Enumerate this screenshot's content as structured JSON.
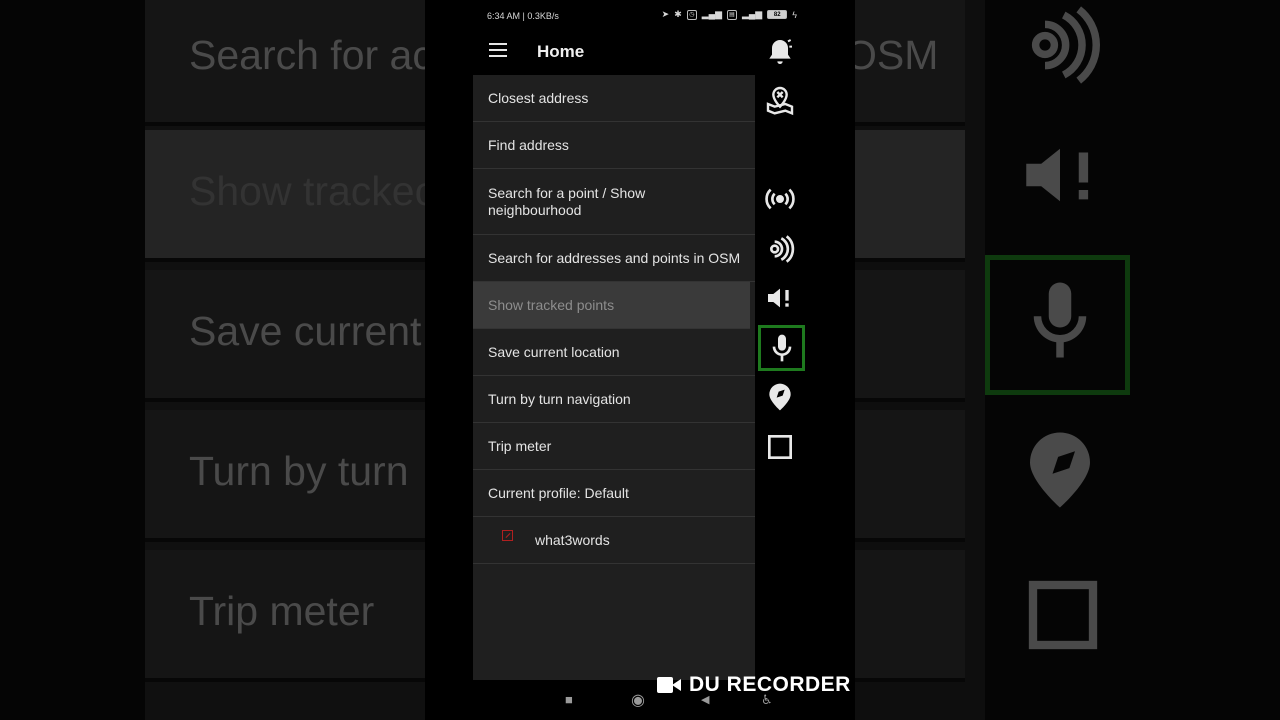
{
  "status_bar": {
    "time_speed": "6:34 AM | 0.3KB/s",
    "battery": "82"
  },
  "app_bar": {
    "title": "Home",
    "menu_icon": "hamburger-menu-icon"
  },
  "menu": {
    "items": [
      {
        "label": "Closest address"
      },
      {
        "label": "Find address"
      },
      {
        "label": "Search for a point / Show neighbourhood"
      },
      {
        "label": "Search for addresses and points in OSM"
      },
      {
        "label": "Show tracked points",
        "selected": true
      },
      {
        "label": "Save current location"
      },
      {
        "label": "Turn by turn navigation"
      },
      {
        "label": "Trip meter"
      },
      {
        "label": "Current profile: Default"
      }
    ],
    "plugin": {
      "label": "what3words",
      "icon": "what3words-icon"
    }
  },
  "side_buttons": [
    {
      "name": "notification-bell-icon"
    },
    {
      "name": "map-marker-cancel-icon"
    },
    {
      "name": "broadcast-icon"
    },
    {
      "name": "radar-icon"
    },
    {
      "name": "speaker-alert-icon"
    },
    {
      "name": "microphone-icon",
      "active": true
    },
    {
      "name": "compass-marker-icon"
    },
    {
      "name": "square-stop-icon"
    }
  ],
  "background_text": {
    "rows": [
      "Search for ac",
      "Show trackec",
      "Save current",
      "Turn by turn",
      "Trip meter"
    ],
    "right_fragment": "OSM"
  },
  "nav_bar": {
    "recent": "■",
    "home": "◉",
    "back": "◀",
    "accessibility": "♿"
  },
  "watermark": {
    "text": "DU RECORDER"
  },
  "colors": {
    "active_outline": "#1e7a1e",
    "list_bg": "#1f1f1f",
    "selected_bg": "#3a3a3a"
  }
}
